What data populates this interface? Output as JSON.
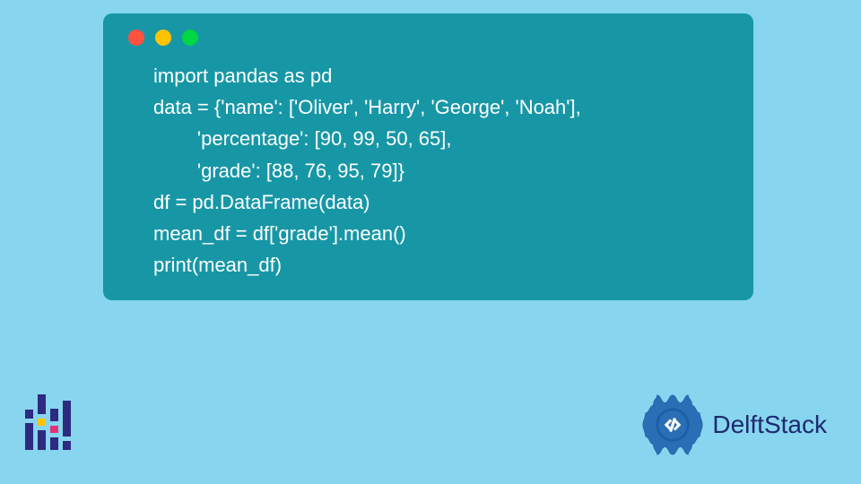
{
  "code": {
    "lines": [
      "import pandas as pd",
      "data = {'name': ['Oliver', 'Harry', 'George', 'Noah'],",
      "        'percentage': [90, 99, 50, 65],",
      "        'grade': [88, 76, 95, 79]}",
      "df = pd.DataFrame(data)",
      "mean_df = df['grade'].mean()",
      "print(mean_df)"
    ]
  },
  "window": {
    "dot_colors": [
      "#ff513f",
      "#ffc400",
      "#00d544"
    ]
  },
  "brand": {
    "name": "DelftStack"
  },
  "eq_icon": {
    "columns": [
      [
        {
          "h": 10,
          "c": "#2d2a80"
        },
        {
          "h": 30,
          "c": "#2d2a80"
        }
      ],
      [
        {
          "h": 22,
          "c": "#2d2a80"
        },
        {
          "h": 8,
          "c": "#ffc400"
        },
        {
          "h": 22,
          "c": "#2d2a80"
        }
      ],
      [
        {
          "h": 14,
          "c": "#2d2a80"
        },
        {
          "h": 8,
          "c": "#e2327a"
        },
        {
          "h": 14,
          "c": "#2d2a80"
        }
      ],
      [
        {
          "h": 40,
          "c": "#2d2a80"
        },
        {
          "h": 10,
          "c": "#2d2a80"
        }
      ]
    ]
  }
}
